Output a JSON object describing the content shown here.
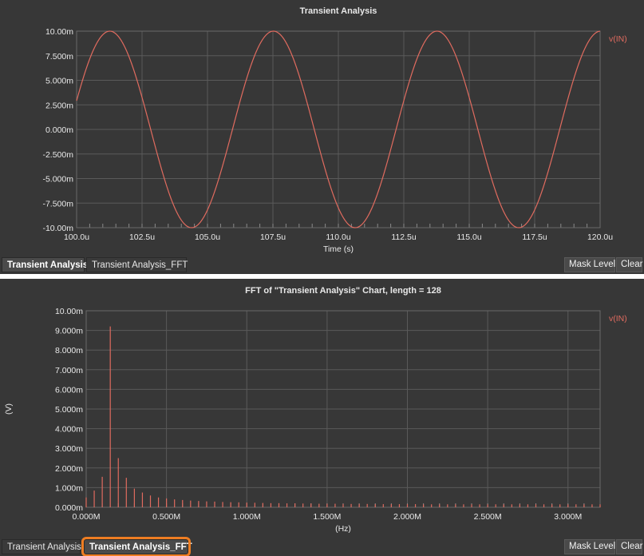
{
  "colors": {
    "background": "#373737",
    "grid": "#5a5a5a",
    "signal": "#e06b5f",
    "text": "#e8e8e8",
    "highlight": "#ee7d22"
  },
  "chart_data": [
    {
      "type": "line",
      "title": "Transient Analysis",
      "xlabel": "Time (s)",
      "ylabel": "",
      "xlim": [
        100.0,
        120.0
      ],
      "ylim": [
        -10.0,
        10.0
      ],
      "x_unit": "u",
      "y_unit": "m",
      "x_ticks": [
        "100.0u",
        "102.5u",
        "105.0u",
        "107.5u",
        "110.0u",
        "112.5u",
        "115.0u",
        "117.5u",
        "120.0u"
      ],
      "y_ticks": [
        "10.00m",
        "7.500m",
        "5.000m",
        "2.500m",
        "0.000m",
        "-2.500m",
        "-5.000m",
        "-7.500m",
        "-10.00m"
      ],
      "grid": true,
      "legend": "top-right",
      "series": [
        {
          "name": "v(IN)",
          "waveform": "sine",
          "amplitude": 10.0,
          "period": 6.25,
          "phase_x0": 100.0,
          "phase_deg": 17,
          "x_start": 100.0,
          "x_end": 120.0
        }
      ]
    },
    {
      "type": "bar",
      "title": "FFT of \"Transient Analysis\" Chart, length = 128",
      "xlabel": "(Hz)",
      "ylabel": "(V)",
      "xlim": [
        0.0,
        3.2
      ],
      "ylim": [
        0.0,
        10.0
      ],
      "x_unit": "M",
      "y_unit": "m",
      "x_ticks": [
        "0.000M",
        "0.500M",
        "1.000M",
        "1.500M",
        "2.000M",
        "2.500M",
        "3.000M"
      ],
      "y_ticks": [
        "10.00m",
        "9.000m",
        "8.000m",
        "7.000m",
        "6.000m",
        "5.000m",
        "4.000m",
        "3.000m",
        "2.000m",
        "1.000m",
        "0.000m"
      ],
      "grid": true,
      "legend": "top-right",
      "series": [
        {
          "name": "v(IN)",
          "bin_width": 0.05,
          "values": [
            0.5,
            0.85,
            1.55,
            9.2,
            2.5,
            1.5,
            0.95,
            0.75,
            0.6,
            0.5,
            0.45,
            0.4,
            0.37,
            0.34,
            0.32,
            0.3,
            0.29,
            0.27,
            0.26,
            0.25,
            0.24,
            0.23,
            0.22,
            0.21,
            0.21,
            0.2,
            0.2,
            0.19,
            0.19,
            0.18,
            0.18,
            0.18,
            0.17,
            0.17,
            0.17,
            0.17,
            0.16,
            0.16,
            0.16,
            0.16,
            0.16,
            0.16,
            0.15,
            0.15,
            0.15,
            0.15,
            0.15,
            0.15,
            0.15,
            0.15,
            0.15,
            0.15,
            0.15,
            0.15,
            0.15,
            0.15,
            0.15,
            0.15,
            0.15,
            0.15,
            0.15,
            0.15,
            0.15,
            0.15,
            0.15
          ]
        }
      ]
    }
  ],
  "top_panel": {
    "tabs": [
      "Transient Analysis",
      "Transient Analysis_FFT"
    ],
    "active_tab": 0,
    "mask_level": "Mask Level",
    "clear": "Clear"
  },
  "bottom_panel": {
    "tabs": [
      "Transient Analysis",
      "Transient Analysis_FFT"
    ],
    "active_tab": 1,
    "mask_level": "Mask Level",
    "clear": "Clear"
  }
}
